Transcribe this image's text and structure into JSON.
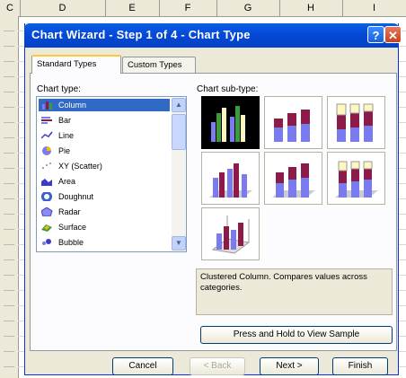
{
  "sheet": {
    "columns": [
      "C",
      "D",
      "E",
      "F",
      "G",
      "H",
      "I"
    ]
  },
  "dialog": {
    "title": "Chart Wizard - Step 1 of 4 - Chart Type",
    "help_label": "?",
    "close_label": "✕",
    "tabs": [
      "Standard Types",
      "Custom Types"
    ],
    "chart_type_label": "Chart type:",
    "chart_subtype_label": "Chart sub-type:",
    "chart_types": [
      {
        "label": "Column",
        "icon": "column-chart-icon",
        "selected": true
      },
      {
        "label": "Bar",
        "icon": "bar-chart-icon"
      },
      {
        "label": "Line",
        "icon": "line-chart-icon"
      },
      {
        "label": "Pie",
        "icon": "pie-chart-icon"
      },
      {
        "label": "XY (Scatter)",
        "icon": "scatter-chart-icon"
      },
      {
        "label": "Area",
        "icon": "area-chart-icon"
      },
      {
        "label": "Doughnut",
        "icon": "doughnut-chart-icon"
      },
      {
        "label": "Radar",
        "icon": "radar-chart-icon"
      },
      {
        "label": "Surface",
        "icon": "surface-chart-icon"
      },
      {
        "label": "Bubble",
        "icon": "bubble-chart-icon"
      }
    ],
    "description": "Clustered Column. Compares values across categories.",
    "preview_button": "Press and Hold to View Sample",
    "buttons": {
      "cancel": "Cancel",
      "back": "< Back",
      "next": "Next >",
      "finish": "Finish"
    }
  },
  "colors": {
    "title_bar": "#0548d4",
    "selection": "#316ac5",
    "bar_blue": "#7b7bf0",
    "bar_maroon": "#8c1b4a",
    "bar_cream": "#fff7c0",
    "bar_green": "#3c9c3c"
  }
}
